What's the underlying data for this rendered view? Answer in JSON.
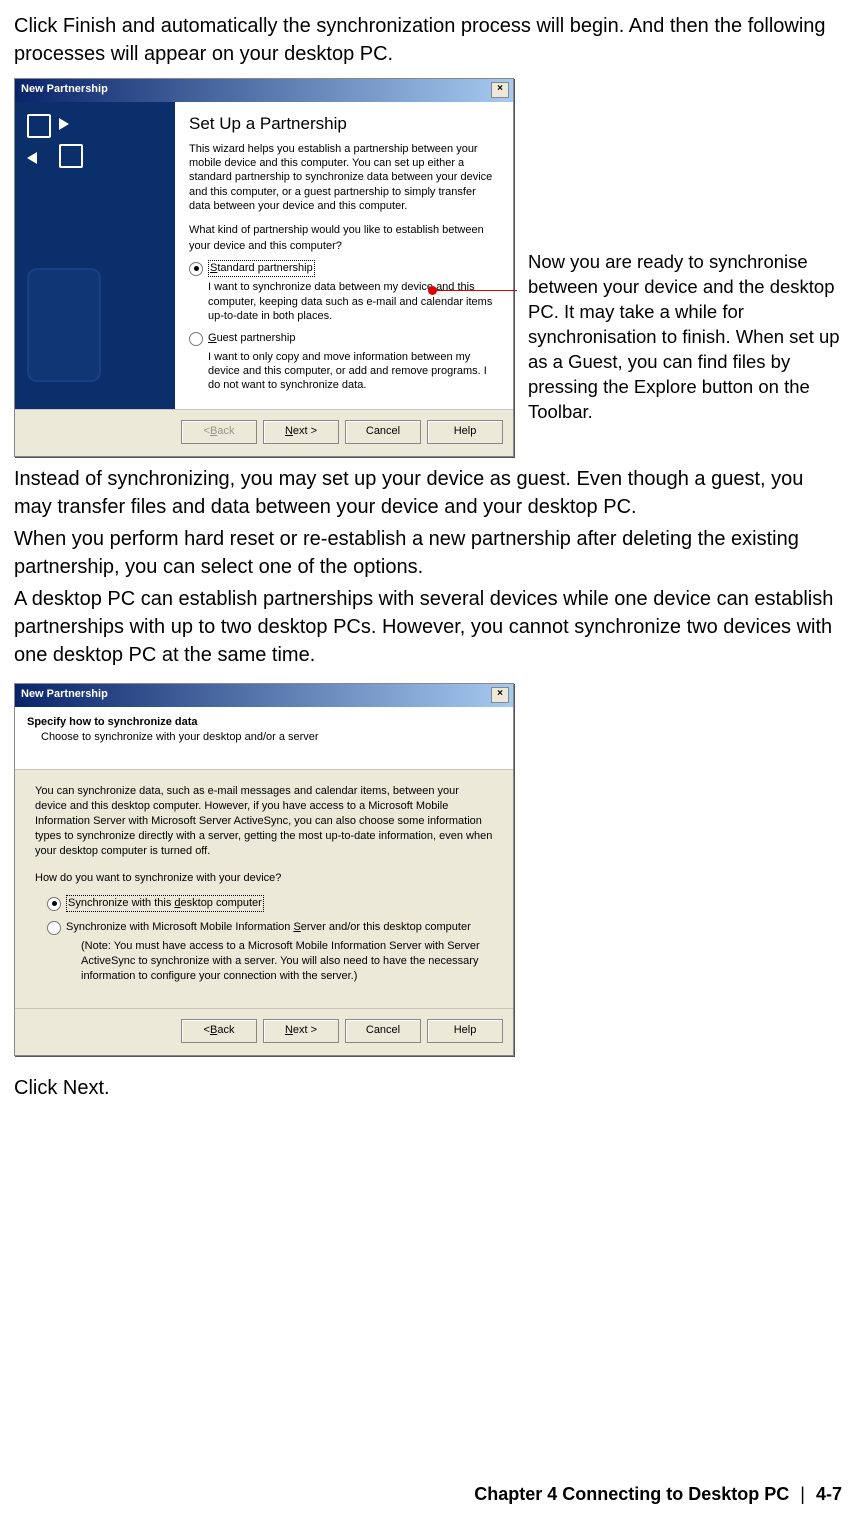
{
  "para1": "Click Finish and automatically the synchronization process will begin. And then the following processes will appear on your desktop PC.",
  "annotation": "Now you are ready to synchronise between your device and the desktop PC. It may take a while for synchronisation to finish.    When set up as a Guest, you can find files by pressing the Explore button on the Toolbar.",
  "para2": "Instead of synchronizing, you may set up your device as guest. Even though a guest, you may transfer files and data between your device and your desktop PC.",
  "para3": "When you perform hard reset or re-establish a new partnership after deleting the existing partnership, you can select one of the options.",
  "para4": "A desktop PC can establish partnerships with several devices while one device can establish partnerships with up to two desktop PCs. However, you cannot synchronize two devices with one desktop PC at the same time.",
  "para5": "Click Next.",
  "dialog1": {
    "title": "New Partnership",
    "heading": "Set Up a Partnership",
    "desc": "This wizard helps you establish a partnership between your mobile device and this computer.  You can set up either a standard partnership to synchronize data between your device and this computer, or a guest partnership to simply transfer data between your device and this computer.",
    "question": "What kind of partnership would you like to establish between your device and this computer?",
    "opt1_label": "Standard partnership",
    "opt1_desc": "I want to synchronize data between my device and this computer, keeping data such as e-mail and calendar items up-to-date in both places.",
    "opt2_label": "Guest partnership",
    "opt2_desc": "I want to only copy and move information between my device and this computer, or add and remove programs.  I do not want to synchronize data.",
    "btn_back": "< Back",
    "btn_next": "Next >",
    "btn_cancel": "Cancel",
    "btn_help": "Help"
  },
  "dialog2": {
    "title": "New Partnership",
    "heading": "Specify how to synchronize data",
    "sub": "Choose to synchronize with your desktop and/or a server",
    "desc": "You can synchronize data, such as e-mail messages and calendar items, between your device and this desktop computer.  However, if you have access to a Microsoft Mobile Information Server with Microsoft Server ActiveSync, you can also choose some information types to synchronize directly with a server, getting the most up-to-date information, even when your desktop computer is turned off.",
    "question": "How do you want to synchronize with your device?",
    "opt1_label": "Synchronize with this desktop computer",
    "opt2_label": "Synchronize with Microsoft Mobile Information Server and/or this desktop computer",
    "note": "(Note: You must have access to a Microsoft Mobile Information Server with Server ActiveSync to synchronize with a server.  You will also need to have the necessary information to configure your connection with the server.)",
    "btn_back": "< Back",
    "btn_next": "Next >",
    "btn_cancel": "Cancel",
    "btn_help": "Help"
  },
  "footer": {
    "chapter": "Chapter 4 Connecting to Desktop PC",
    "page": "4-7"
  }
}
